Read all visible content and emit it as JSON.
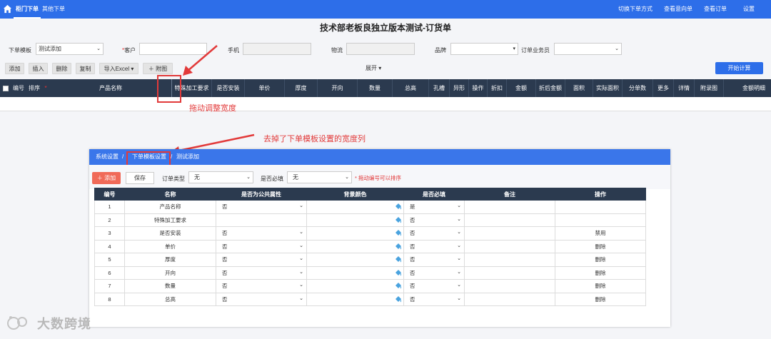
{
  "topbar": {
    "tabs": [
      "柜门下单",
      "其他下单"
    ],
    "links": [
      "切换下单方式",
      "查看意向单",
      "查看订单",
      "设置"
    ]
  },
  "page_title": "技术部老板良独立版本测试-订货单",
  "form": {
    "template_label": "下单模板",
    "template_value": "测试添加",
    "customer_label": "客户",
    "customer_required": "*",
    "phone_label": "手机",
    "logistics_label": "物流",
    "brand_label": "品牌",
    "salesman_label": "订单业务员"
  },
  "toolbar": {
    "buttons": [
      "添加",
      "插入",
      "删除",
      "复制",
      "导入Excel ▾",
      "＋ 附图"
    ],
    "expand": "展开 ▾",
    "start": "开始计算"
  },
  "grid": {
    "columns": [
      "编号",
      "排序",
      "*",
      "产品名称",
      "特殊加工要求",
      "是否安装",
      "单价",
      "厚度",
      "开向",
      "数量",
      "总高",
      "孔槽",
      "异形",
      "操作",
      "折扣",
      "金额",
      "折后金额",
      "面积",
      "实际面积",
      "分单数",
      "更多",
      "详情",
      "附录图",
      "金额明细"
    ]
  },
  "annotations": {
    "drag_note": "拖动调整宽度",
    "removed_note": "去掉了下单模板设置的宽度列"
  },
  "panel": {
    "breadcrumb": [
      "系统设置",
      "/",
      "下单模板设置",
      "/",
      "测试添加"
    ],
    "add_button": "＋ 添加",
    "save_button": "保存",
    "order_type_label": "订单类型",
    "order_type_value": "无",
    "required_label": "是否必填",
    "required_value": "无",
    "hint": "* 拖动编号可以排序",
    "table": {
      "headers": [
        "编号",
        "名称",
        "是否为公共属性",
        "背景颜色",
        "是否必填",
        "备注",
        "操作"
      ],
      "rows": [
        {
          "no": "1",
          "name": "产品名称",
          "public": "否",
          "required": "是",
          "note": "",
          "action": ""
        },
        {
          "no": "2",
          "name": "特殊加工要求",
          "public": "",
          "required": "否",
          "note": "",
          "action": ""
        },
        {
          "no": "3",
          "name": "是否安装",
          "public": "否",
          "required": "否",
          "note": "",
          "action": "禁用"
        },
        {
          "no": "4",
          "name": "单价",
          "public": "否",
          "required": "否",
          "note": "",
          "action": "删除"
        },
        {
          "no": "5",
          "name": "厚度",
          "public": "否",
          "required": "否",
          "note": "",
          "action": "删除"
        },
        {
          "no": "6",
          "name": "开向",
          "public": "否",
          "required": "否",
          "note": "",
          "action": "删除"
        },
        {
          "no": "7",
          "name": "数量",
          "public": "否",
          "required": "否",
          "note": "",
          "action": "删除"
        },
        {
          "no": "8",
          "name": "总高",
          "public": "否",
          "required": "否",
          "note": "",
          "action": "删除"
        }
      ]
    }
  },
  "watermark": "大数跨境",
  "colors": {
    "primary": "#2d6ee9",
    "header_dark": "#2b3a4f",
    "annotation_red": "#e23a3a",
    "add_button": "#f06a58"
  }
}
